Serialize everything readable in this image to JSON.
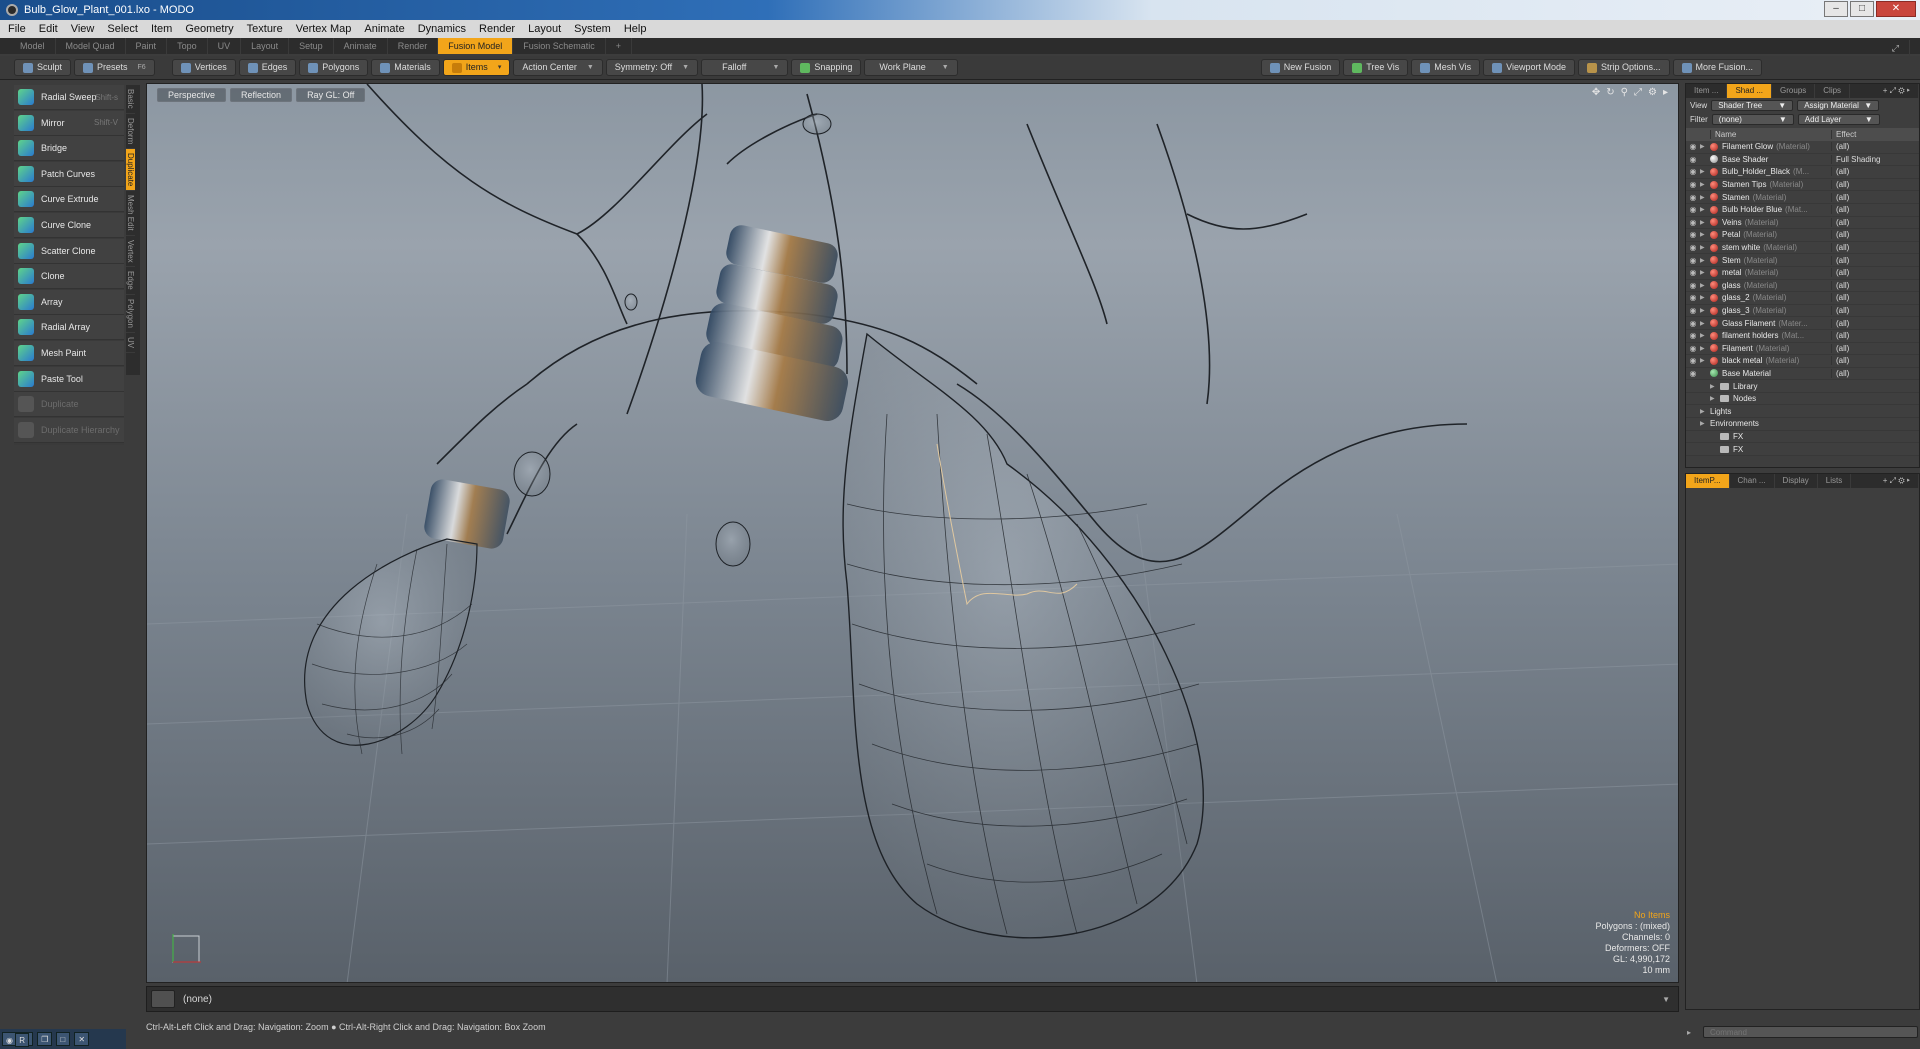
{
  "window": {
    "title": "Bulb_Glow_Plant_001.lxo - MODO",
    "min_label": "–",
    "max_label": "□",
    "close_label": "✕"
  },
  "menu": [
    "File",
    "Edit",
    "View",
    "Select",
    "Item",
    "Geometry",
    "Texture",
    "Vertex Map",
    "Animate",
    "Dynamics",
    "Render",
    "Layout",
    "System",
    "Help"
  ],
  "layouts": {
    "tabs": [
      "Model",
      "Model Quad",
      "Paint",
      "Topo",
      "UV",
      "Layout",
      "Setup",
      "Animate",
      "Render",
      "Fusion Model",
      "Fusion Schematic"
    ],
    "active": "Fusion Model",
    "add": "+"
  },
  "toolbar": {
    "sculpt": "Sculpt",
    "presets": "Presets",
    "presets_key": "F6",
    "vertices": "Vertices",
    "edges": "Edges",
    "polygons": "Polygons",
    "materials": "Materials",
    "items": "Items",
    "action_center": "Action Center",
    "symmetry": "Symmetry: Off",
    "falloff": "Falloff",
    "snapping": "Snapping",
    "work_plane": "Work Plane",
    "new_fusion": "New Fusion",
    "tree_vis": "Tree Vis",
    "mesh_vis": "Mesh Vis",
    "viewport_mode": "Viewport Mode",
    "strip_options": "Strip Options...",
    "more_fusion": "More Fusion..."
  },
  "tools": [
    {
      "label": "Radial Sweep",
      "shortcut": "Shift-s",
      "enabled": true
    },
    {
      "label": "Mirror",
      "shortcut": "Shift-V",
      "enabled": true
    },
    {
      "label": "Bridge",
      "shortcut": "",
      "enabled": true
    },
    {
      "label": "Patch Curves",
      "shortcut": "",
      "enabled": true
    },
    {
      "label": "Curve Extrude",
      "shortcut": "",
      "enabled": true
    },
    {
      "label": "Curve Clone",
      "shortcut": "",
      "enabled": true
    },
    {
      "label": "Scatter Clone",
      "shortcut": "",
      "enabled": true
    },
    {
      "label": "Clone",
      "shortcut": "",
      "enabled": true
    },
    {
      "label": "Array",
      "shortcut": "",
      "enabled": true
    },
    {
      "label": "Radial Array",
      "shortcut": "",
      "enabled": true
    },
    {
      "label": "Mesh Paint",
      "shortcut": "",
      "enabled": true
    },
    {
      "label": "Paste Tool",
      "shortcut": "",
      "enabled": true
    },
    {
      "label": "Duplicate",
      "shortcut": "",
      "enabled": false
    },
    {
      "label": "Duplicate Hierarchy",
      "shortcut": "",
      "enabled": false
    }
  ],
  "side_tabs": [
    "Basic",
    "Deform",
    "Duplicate",
    "Mesh Edit",
    "Vertex",
    "Edge",
    "Polygon",
    "UV"
  ],
  "side_tab_active": "Duplicate",
  "viewport": {
    "view": "Perspective",
    "shading": "Reflection",
    "raygl": "Ray GL: Off"
  },
  "stats": {
    "items": "No Items",
    "polygons": "Polygons : (mixed)",
    "channels": "Channels: 0",
    "deformers": "Deformers: OFF",
    "gl": "GL: 4,990,172",
    "scale": "10 mm"
  },
  "status": {
    "selection": "(none)",
    "hint": "Ctrl-Alt-Left Click and Drag: Navigation: Zoom ● Ctrl-Alt-Right Click and Drag: Navigation: Box Zoom"
  },
  "shader_panel": {
    "tabs": [
      "Item ...",
      "Shad ...",
      "Groups",
      "Clips"
    ],
    "active_tab": "Shad ...",
    "view_label": "View",
    "view_value": "Shader Tree",
    "assign": "Assign Material",
    "filter_label": "Filter",
    "filter_value": "(none)",
    "add_layer": "Add Layer",
    "col_name": "Name",
    "col_effect": "Effect",
    "rows": [
      {
        "name": "Filament Glow",
        "type": "(Material)",
        "effect": "(all)",
        "icon": "red"
      },
      {
        "name": "Base Shader",
        "type": "",
        "effect": "Full Shading",
        "icon": "white"
      },
      {
        "name": "Bulb_Holder_Black",
        "type": "(M...",
        "effect": "(all)",
        "icon": "red"
      },
      {
        "name": "Stamen Tips",
        "type": "(Material)",
        "effect": "(all)",
        "icon": "red"
      },
      {
        "name": "Stamen",
        "type": "(Material)",
        "effect": "(all)",
        "icon": "red"
      },
      {
        "name": "Bulb Holder Blue",
        "type": "(Mat...",
        "effect": "(all)",
        "icon": "red"
      },
      {
        "name": "Veins",
        "type": "(Material)",
        "effect": "(all)",
        "icon": "red"
      },
      {
        "name": "Petal",
        "type": "(Material)",
        "effect": "(all)",
        "icon": "red"
      },
      {
        "name": "stem white",
        "type": "(Material)",
        "effect": "(all)",
        "icon": "red"
      },
      {
        "name": "Stem",
        "type": "(Material)",
        "effect": "(all)",
        "icon": "red"
      },
      {
        "name": "metal",
        "type": "(Material)",
        "effect": "(all)",
        "icon": "red"
      },
      {
        "name": "glass",
        "type": "(Material)",
        "effect": "(all)",
        "icon": "red"
      },
      {
        "name": "glass_2",
        "type": "(Material)",
        "effect": "(all)",
        "icon": "red"
      },
      {
        "name": "glass_3",
        "type": "(Material)",
        "effect": "(all)",
        "icon": "red"
      },
      {
        "name": "Glass Filament",
        "type": "(Mater...",
        "effect": "(all)",
        "icon": "red"
      },
      {
        "name": "filament holders",
        "type": "(Mat...",
        "effect": "(all)",
        "icon": "red"
      },
      {
        "name": "Filament",
        "type": "(Material)",
        "effect": "(all)",
        "icon": "red"
      },
      {
        "name": "black metal",
        "type": "(Material)",
        "effect": "(all)",
        "icon": "red"
      },
      {
        "name": "Base Material",
        "type": "",
        "effect": "(all)",
        "icon": "green"
      }
    ],
    "folders": [
      "Library",
      "Nodes",
      "Lights",
      "Environments",
      "FX",
      "FX"
    ]
  },
  "props_panel": {
    "tabs": [
      "ItemP...",
      "Chan ...",
      "Display",
      "Lists"
    ],
    "active_tab": "ItemP..."
  },
  "command": {
    "placeholder": "Command"
  },
  "taskbar": {
    "app": "R"
  },
  "colors": {
    "accent": "#f2a51a",
    "material_ball": "#c0392b",
    "viewport_bg": "#8c97a2"
  }
}
